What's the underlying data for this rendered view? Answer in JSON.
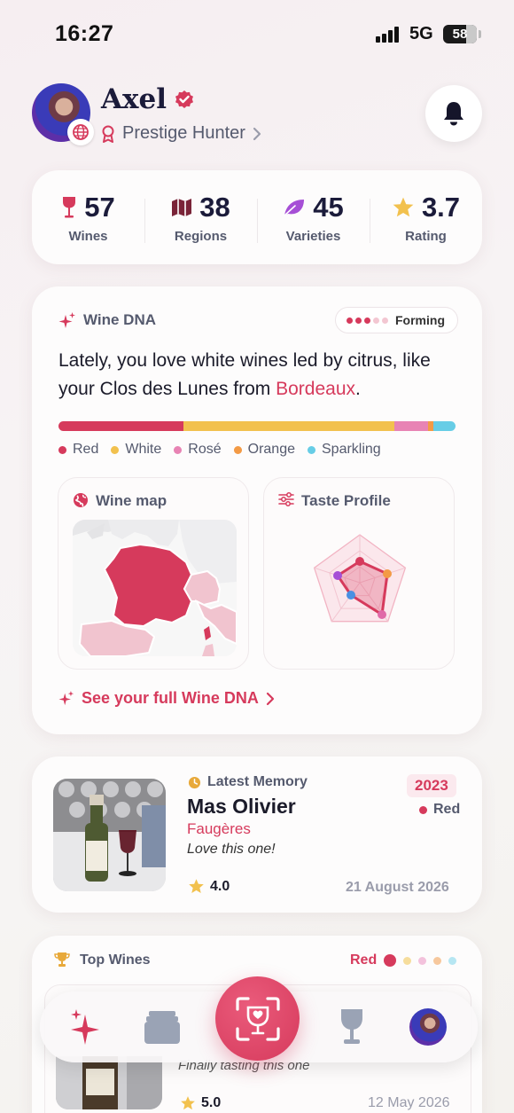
{
  "status_bar": {
    "time": "16:27",
    "network": "5G",
    "battery": "58"
  },
  "profile": {
    "name": "Axel",
    "rank": "Prestige Hunter"
  },
  "stats": [
    {
      "value": "57",
      "label": "Wines",
      "icon": "wine-glass-icon"
    },
    {
      "value": "38",
      "label": "Regions",
      "icon": "map-icon"
    },
    {
      "value": "45",
      "label": "Varieties",
      "icon": "leaf-icon"
    },
    {
      "value": "3.7",
      "label": "Rating",
      "icon": "star-icon"
    }
  ],
  "wine_dna": {
    "title": "Wine DNA",
    "status": "Forming",
    "sentence_prefix": "Lately, you love white wines led by citrus, like your Clos des Lunes from ",
    "sentence_highlight": "Bordeaux",
    "sentence_suffix": ".",
    "breakdown": [
      {
        "label": "Red",
        "share": 0.315,
        "color": "#d63a5c"
      },
      {
        "label": "White",
        "share": 0.53,
        "color": "#f2c14e"
      },
      {
        "label": "Rosé",
        "share": 0.085,
        "color": "#e883b4"
      },
      {
        "label": "Orange",
        "share": 0.015,
        "color": "#f39a45"
      },
      {
        "label": "Sparkling",
        "share": 0.055,
        "color": "#67cde6"
      }
    ],
    "map_title": "Wine map",
    "taste_title": "Taste Profile",
    "see_more": "See your full Wine DNA"
  },
  "latest_memory": {
    "tag": "Latest Memory",
    "name": "Mas Olivier",
    "region": "Faugères",
    "note": "Love this one!",
    "rating": "4.0",
    "vintage": "2023",
    "color": "Red",
    "date": "21 August 2026"
  },
  "top_wines": {
    "title": "Top Wines",
    "filter": "Red",
    "note": "Finally tasting this one",
    "rating": "5.0",
    "date": "12 May 2026"
  },
  "colors": {
    "accent": "#d63a5c",
    "star": "#f2c14e",
    "text_muted": "#555a6e"
  }
}
